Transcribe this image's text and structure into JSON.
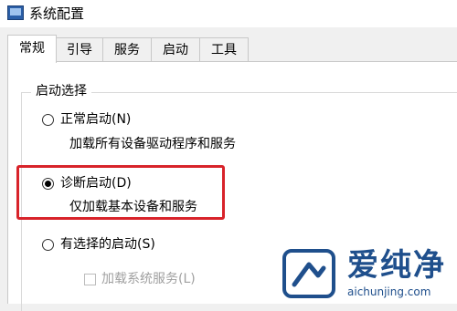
{
  "window": {
    "title": "系统配置",
    "icon": "monitor-icon"
  },
  "tabs": [
    {
      "label": "常规",
      "active": true
    },
    {
      "label": "引导",
      "active": false
    },
    {
      "label": "服务",
      "active": false
    },
    {
      "label": "启动",
      "active": false
    },
    {
      "label": "工具",
      "active": false
    }
  ],
  "startup_selection": {
    "group_label": "启动选择",
    "options": [
      {
        "label": "正常启动(N)",
        "description": "加载所有设备驱动程序和服务",
        "selected": false
      },
      {
        "label": "诊断启动(D)",
        "description": "仅加载基本设备和服务",
        "selected": true
      },
      {
        "label": "有选择的启动(S)",
        "selected": false
      }
    ],
    "sub_options": [
      {
        "label": "加载系统服务(L)",
        "checked": false,
        "enabled": false
      }
    ]
  },
  "colors": {
    "highlight": "#d8232a",
    "watermark": "#1f4f8c"
  },
  "watermark": {
    "brand": "爱纯净",
    "url": "aichunjing.com"
  }
}
